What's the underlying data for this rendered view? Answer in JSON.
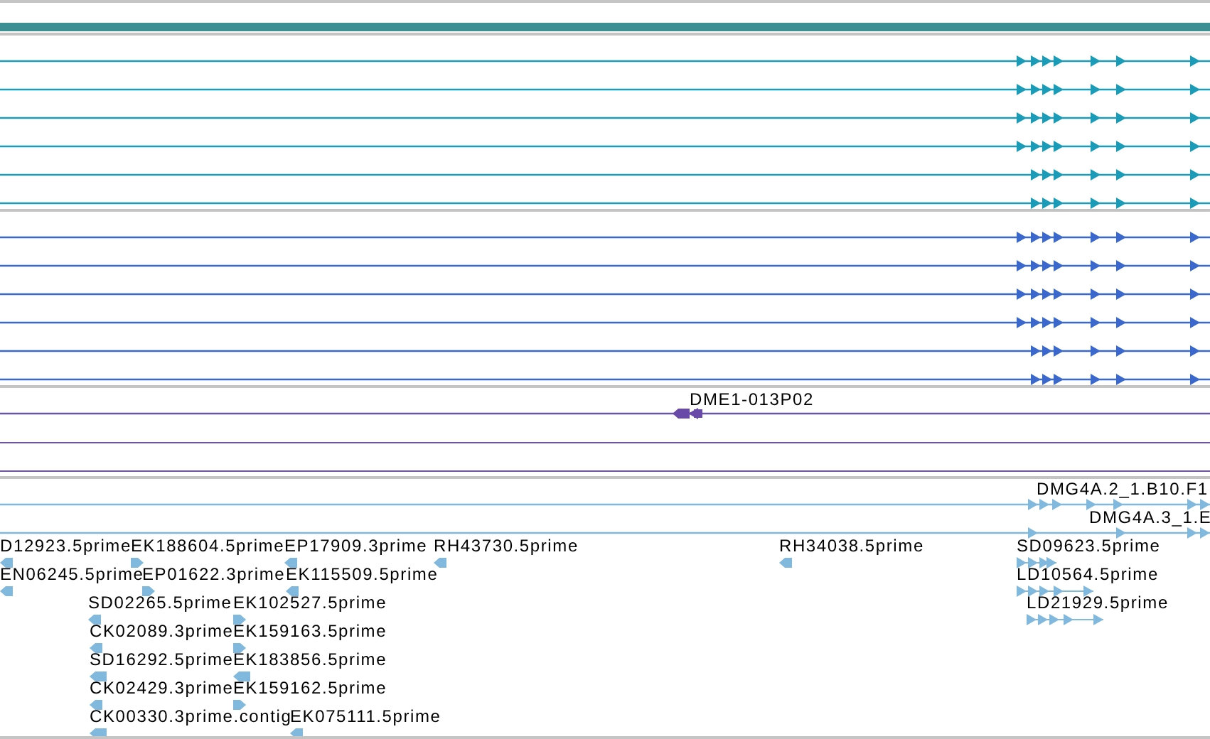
{
  "transcript_tracks": [
    {
      "color": "#1a9cb8",
      "rows": [
        {
          "kind": "long"
        },
        {
          "kind": "long"
        },
        {
          "kind": "long"
        },
        {
          "kind": "long"
        },
        {
          "kind": "short"
        },
        {
          "kind": "short"
        }
      ]
    },
    {
      "color": "#3a68cc",
      "rows": [
        {
          "kind": "long"
        },
        {
          "kind": "long"
        },
        {
          "kind": "long"
        },
        {
          "kind": "long"
        },
        {
          "kind": "short"
        },
        {
          "kind": "short"
        }
      ]
    }
  ],
  "clone_track": {
    "label": "DME1-013P02",
    "reverse": true
  },
  "est_reads": [
    {
      "label": "DMG4A.2_1.B10.F1",
      "reverse": false
    },
    {
      "label": "DMG4A.3_1.E",
      "reverse": false
    }
  ],
  "est_labels": [
    {
      "label": "D12923.5prime",
      "reverse": true,
      "kind": "single"
    },
    {
      "label": "EK188604.5prime",
      "reverse": false,
      "kind": "single"
    },
    {
      "label": "EP17909.3prime",
      "reverse": true,
      "kind": "single"
    },
    {
      "label": "RH43730.5prime",
      "reverse": true,
      "kind": "single"
    },
    {
      "label": "RH34038.5prime",
      "reverse": true,
      "kind": "single"
    },
    {
      "label": "SD09623.5prime",
      "reverse": false,
      "kind": "spliced"
    },
    {
      "label": "EN06245.5prime",
      "reverse": true,
      "kind": "single"
    },
    {
      "label": "EP01622.3prime",
      "reverse": false,
      "kind": "single"
    },
    {
      "label": "EK115509.5prime",
      "reverse": true,
      "kind": "single"
    },
    {
      "label": "LD10564.5prime",
      "reverse": false,
      "kind": "spliced"
    },
    {
      "label": "SD02265.5prime",
      "reverse": true,
      "kind": "single"
    },
    {
      "label": "EK102527.5prime",
      "reverse": false,
      "kind": "single"
    },
    {
      "label": "LD21929.5prime",
      "reverse": false,
      "kind": "spliced"
    },
    {
      "label": "CK02089.3prime",
      "reverse": true,
      "kind": "single"
    },
    {
      "label": "EK159163.5prime",
      "reverse": false,
      "kind": "single"
    },
    {
      "label": "SD16292.5prime",
      "reverse": true,
      "kind": "single"
    },
    {
      "label": "EK183856.5prime",
      "reverse": true,
      "kind": "single"
    },
    {
      "label": "CK02429.3prime",
      "reverse": true,
      "kind": "single"
    },
    {
      "label": "EK159162.5prime",
      "reverse": false,
      "kind": "single"
    },
    {
      "label": "CK00330.3prime.contig",
      "reverse": true,
      "kind": "single"
    },
    {
      "label": "EK075111.5prime",
      "reverse": true,
      "kind": "single"
    }
  ]
}
